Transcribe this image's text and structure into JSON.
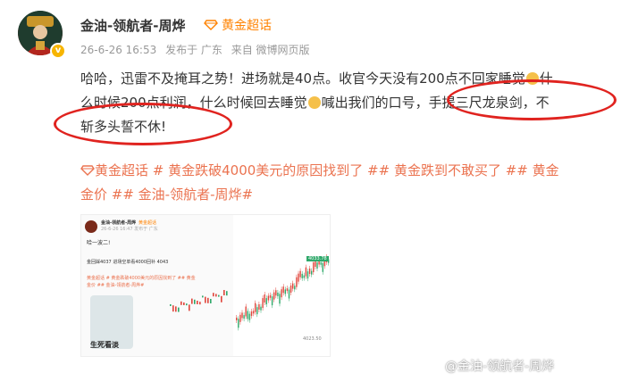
{
  "post": {
    "author": "金油-领航者-周烨",
    "topic_badge": "黄金超话",
    "meta": {
      "time": "26-6-26 16:53",
      "location": "发布于 广东",
      "source": "来自 微博网页版"
    },
    "content_lines": [
      "哈哈，迅雷不及掩耳之势！进场就是40点。收官今天没有200点不回家睡觉",
      "什么时候200点利润，什么时候回去睡觉",
      "喊出我们的口号，手提三尺龙泉剑，不",
      "斩多头誓不休!"
    ],
    "content_fragments": {
      "line1_tail": "什",
      "line2_head": "么时候200点利润，什么时候回去睡觉",
      "line2_tail": "喊出我们的口号，手提三尺龙泉剑，不"
    },
    "hashtags_lines": [
      "黄金超话 # 黄金跌破4000美元的原因找到了 ## 黄金跌到不敢买了 ## 黄金",
      "金价 ## 金油-领航者-周烨#"
    ],
    "image": {
      "mini_author": "金油-领航者-周烨",
      "mini_topic": "黄金超话",
      "mini_time": "26-6-26 16:47 发布于 广东",
      "mini_text1": "哈一波二!",
      "mini_text2": "金回踩4037 进场空单看4000回补 4043",
      "mini_text3": "黄金超话 # 黄金跌破4000美元的原因找到了 ## 黄金",
      "mini_text4": "金价 ## 金油-领航者-周烨#",
      "cartoon_caption": "生死看淡",
      "price_label": "4033.78",
      "price_bottom": "4023.50"
    },
    "watermark": "@金油-领航者-周烨"
  },
  "colors": {
    "topic_orange": "#ff8200",
    "hashtag": "#eb7350",
    "annotation_red": "#e0231f",
    "candle_up": "#e0443a",
    "candle_down": "#2fa86a"
  }
}
